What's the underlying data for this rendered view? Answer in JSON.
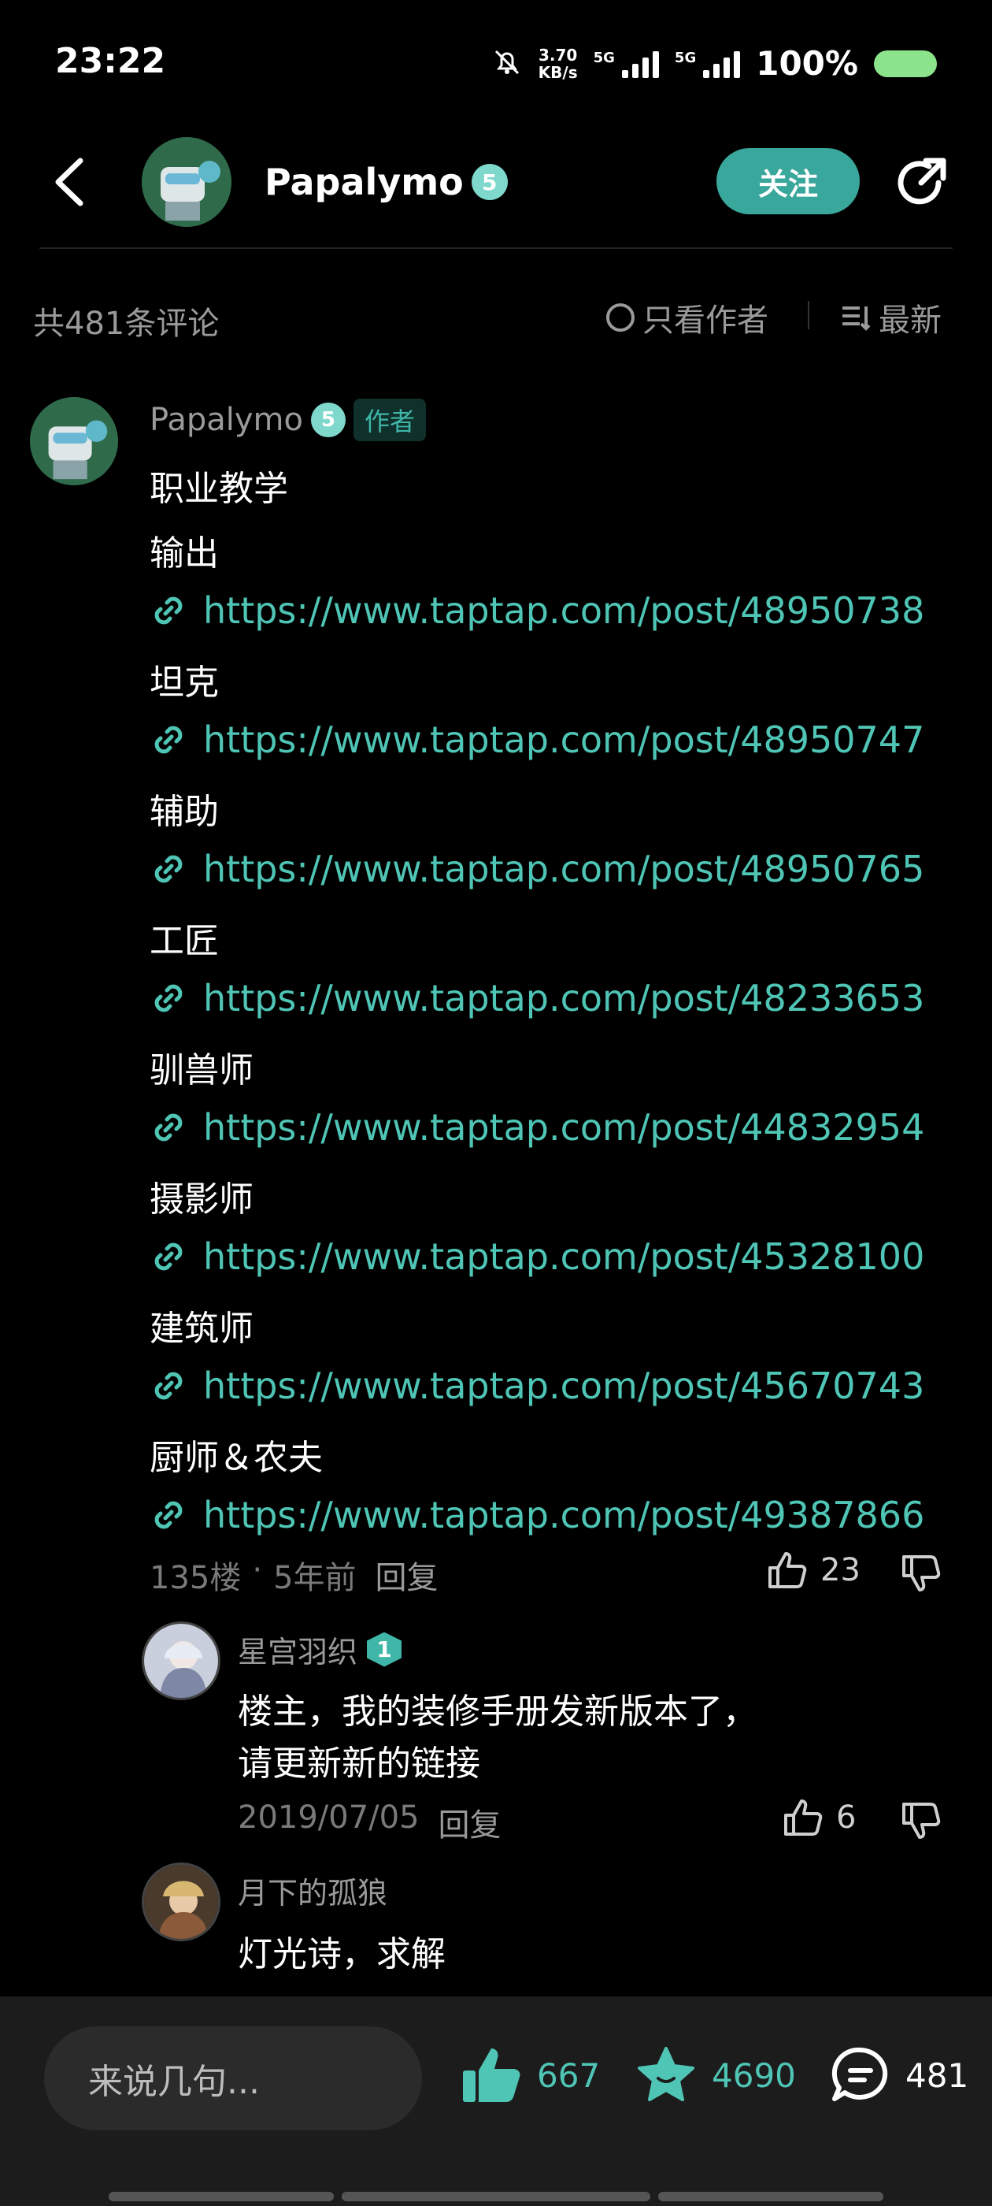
{
  "status_bar": {
    "time": "23:22",
    "speed_value": "3.70",
    "speed_unit": "KB/s",
    "net1": "5G",
    "net2": "5G",
    "battery_pct": "100%",
    "icons": [
      "mute-bell-icon",
      "signal-icon",
      "signal-icon",
      "battery-icon"
    ]
  },
  "header": {
    "title": "Papalymo",
    "level": "5",
    "follow_label": "关注",
    "icons": [
      "back-arrow-icon",
      "share-icon"
    ]
  },
  "comments_bar": {
    "count_prefix": "共",
    "count": "481",
    "count_suffix": "条评论",
    "only_author": "只看作者",
    "sort_label": "最新"
  },
  "main_comment": {
    "author": "Papalymo",
    "level": "5",
    "author_tag": "作者",
    "title": "职业教学",
    "sections": [
      {
        "label": "输出",
        "url": "https://www.taptap.com/post/48950738"
      },
      {
        "label": "坦克",
        "url": "https://www.taptap.com/post/48950747"
      },
      {
        "label": "辅助",
        "url": "https://www.taptap.com/post/48950765"
      },
      {
        "label": "工匠",
        "url": "https://www.taptap.com/post/48233653"
      },
      {
        "label": "驯兽师",
        "url": "https://www.taptap.com/post/44832954"
      },
      {
        "label": "摄影师",
        "url": "https://www.taptap.com/post/45328100"
      },
      {
        "label": "建筑师",
        "url": "https://www.taptap.com/post/45670743"
      },
      {
        "label": "厨师＆农夫",
        "url": "https://www.taptap.com/post/49387866"
      }
    ],
    "floor": "135楼",
    "dot": "·",
    "time": "5年前",
    "reply_label": "回复",
    "likes": "23"
  },
  "replies": [
    {
      "author": "星宫羽织",
      "level": "1",
      "text_line1": "楼主，我的装修手册发新版本了，",
      "text_line2": "请更新新的链接",
      "date": "2019/07/05",
      "reply_label": "回复",
      "likes": "6"
    },
    {
      "author": "月下的孤狼",
      "text_line1": "灯光诗，求解"
    }
  ],
  "bottom_bar": {
    "input_placeholder": "来说几句...",
    "likes": "667",
    "favorites": "4690",
    "comments": "481",
    "colors": {
      "accent": "#4fc5b5",
      "background": "#1c1c1c"
    }
  }
}
